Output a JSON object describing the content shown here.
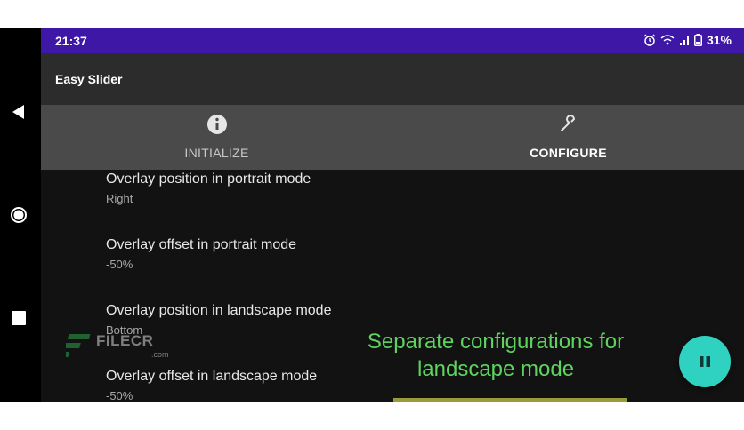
{
  "status_bar": {
    "time": "21:37",
    "battery": "31%",
    "icons": [
      "alarm-icon",
      "wifi-icon",
      "signal-icon",
      "battery-icon"
    ],
    "color": "#3e17a6"
  },
  "app": {
    "title": "Easy Slider"
  },
  "tabs": [
    {
      "label": "INITIALIZE",
      "icon": "info-icon",
      "selected": false
    },
    {
      "label": "CONFIGURE",
      "icon": "wrench-icon",
      "selected": true
    }
  ],
  "settings": [
    {
      "title": "Overlay position in portrait mode",
      "value": "Right"
    },
    {
      "title": "Overlay offset in portrait mode",
      "value": "-50%"
    },
    {
      "title": "Overlay position in landscape mode",
      "value": "Bottom"
    },
    {
      "title": "Overlay offset in landscape mode",
      "value": "-50%"
    }
  ],
  "caption": {
    "line1": "Separate configurations for",
    "line2": "landscape mode",
    "color": "#5fd35f"
  },
  "watermark": {
    "text": "FILECR",
    "sub": ".com"
  },
  "fab": {
    "icon": "pause-icon",
    "color": "#2fd1c0"
  },
  "nav": [
    "back-icon",
    "home-icon",
    "recents-icon"
  ]
}
